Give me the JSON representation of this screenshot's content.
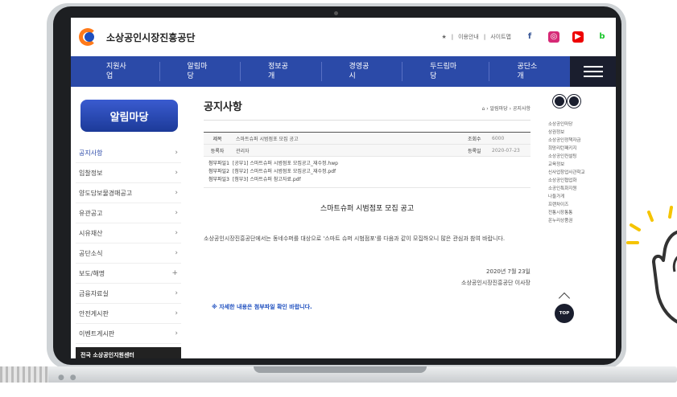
{
  "header": {
    "logo_text": "소상공인시장진흥공단",
    "top_links": [
      "★",
      "이용안내",
      "사이트맵"
    ],
    "sns_icons": [
      "facebook-icon",
      "instagram-icon",
      "youtube-icon",
      "blog-icon"
    ]
  },
  "nav": {
    "items": [
      "지원사업",
      "알림마당",
      "정보공개",
      "경영공시",
      "두드림마당",
      "공단소개"
    ]
  },
  "sidebar": {
    "title": "알림마당",
    "items": [
      {
        "label": "공지사항",
        "marker": "›"
      },
      {
        "label": "입찰정보",
        "marker": "›"
      },
      {
        "label": "양도담보물경매공고",
        "marker": "›"
      },
      {
        "label": "유관공고",
        "marker": "›"
      },
      {
        "label": "시유재산",
        "marker": "›"
      },
      {
        "label": "공단소식",
        "marker": "›"
      },
      {
        "label": "보도/해명",
        "marker": "+"
      },
      {
        "label": "금융자료실",
        "marker": "›"
      },
      {
        "label": "안전게시판",
        "marker": "›"
      },
      {
        "label": "이벤트게시판",
        "marker": "›"
      }
    ],
    "bottom_label": "전국 소상공인지원센터"
  },
  "main": {
    "title": "공지사항",
    "breadcrumb": "⌂ › 알림마당 › 공지사항",
    "subject_key": "제목",
    "subject": "스마트슈퍼 시범점포 모집 공고",
    "views_key": "조회수",
    "views": "6000",
    "writer_key": "등록자",
    "writer": "관리자",
    "date_key": "등록일",
    "date": "2020-07-23",
    "files": [
      {
        "key": "첨부파일1",
        "name": "[공부1] 스마트슈퍼 시범점포 모집공고_재수정.hwp"
      },
      {
        "key": "첨부파일2",
        "name": "[첨부2] 스마트슈퍼 시범점포 모집공고_재수정.pdf"
      },
      {
        "key": "첨부파일3",
        "name": "[첨부3] 스마트슈퍼 참고자료.pdf"
      }
    ],
    "post_title": "스마트슈퍼 시범점포 모집 공고",
    "post_body": "소상공인시장진흥공단에서는 동네수퍼를 대상으로 '스마트 슈퍼 시범점포'를 다음과 같이 모집하오니 많은 관심과 참여 바랍니다.",
    "post_date": "2020년 7월 23일",
    "post_org": "소상공인시장진흥공단 이사장",
    "post_note": "※ 자세한 내용은 첨부파일 확인 바랍니다."
  },
  "rightbar": {
    "items": [
      "소상공인마당",
      "상권정보",
      "소상공인정책자금",
      "희망리턴패키지",
      "소상공인컨설팅",
      "교육정보",
      "신사업창업사관학교",
      "소상공인협업화",
      "소공인특화지원",
      "나들가게",
      "프랜차이즈",
      "전통시장통통",
      "온누리상품권"
    ],
    "top_label": "TOP"
  },
  "colors": {
    "nav_bg": "#2b4aa8",
    "accent": "#1e4fbf",
    "logo_orange": "#ff7a1a",
    "dark": "#1a1e2e"
  }
}
